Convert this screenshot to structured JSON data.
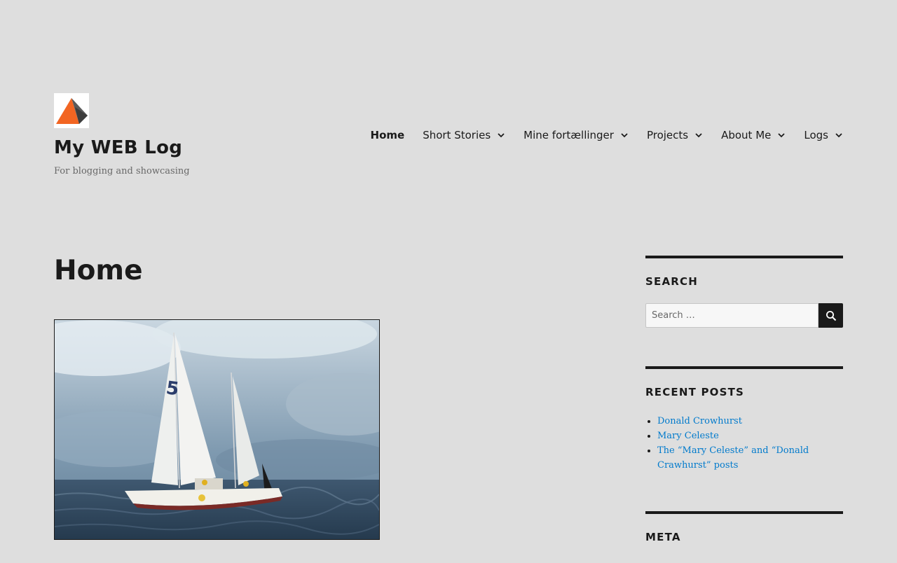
{
  "site": {
    "title": "My WEB Log",
    "tagline": "For blogging and showcasing",
    "logo_icon": "orange-triangle-logo"
  },
  "nav": {
    "items": [
      {
        "label": "Home",
        "active": true,
        "has_submenu": false
      },
      {
        "label": "Short Stories",
        "active": false,
        "has_submenu": true
      },
      {
        "label": "Mine fortællinger",
        "active": false,
        "has_submenu": true
      },
      {
        "label": "Projects",
        "active": false,
        "has_submenu": true
      },
      {
        "label": "About Me",
        "active": false,
        "has_submenu": true
      },
      {
        "label": "Logs",
        "active": false,
        "has_submenu": true
      }
    ]
  },
  "main": {
    "page_title": "Home",
    "featured_image": "sailing-trimaran-photo"
  },
  "sidebar": {
    "search": {
      "title": "Search",
      "placeholder": "Search …",
      "button_icon": "search-icon"
    },
    "recent_posts": {
      "title": "Recent Posts",
      "items": [
        "Donald Crowhurst",
        "Mary Celeste",
        "The “Mary Celeste” and “Donald Crawhurst” posts"
      ]
    },
    "meta": {
      "title": "Meta"
    }
  },
  "colors": {
    "background": "#dedede",
    "text": "#1a1a1a",
    "link": "#007acc",
    "muted": "#686868",
    "logo_orange": "#f26522"
  }
}
